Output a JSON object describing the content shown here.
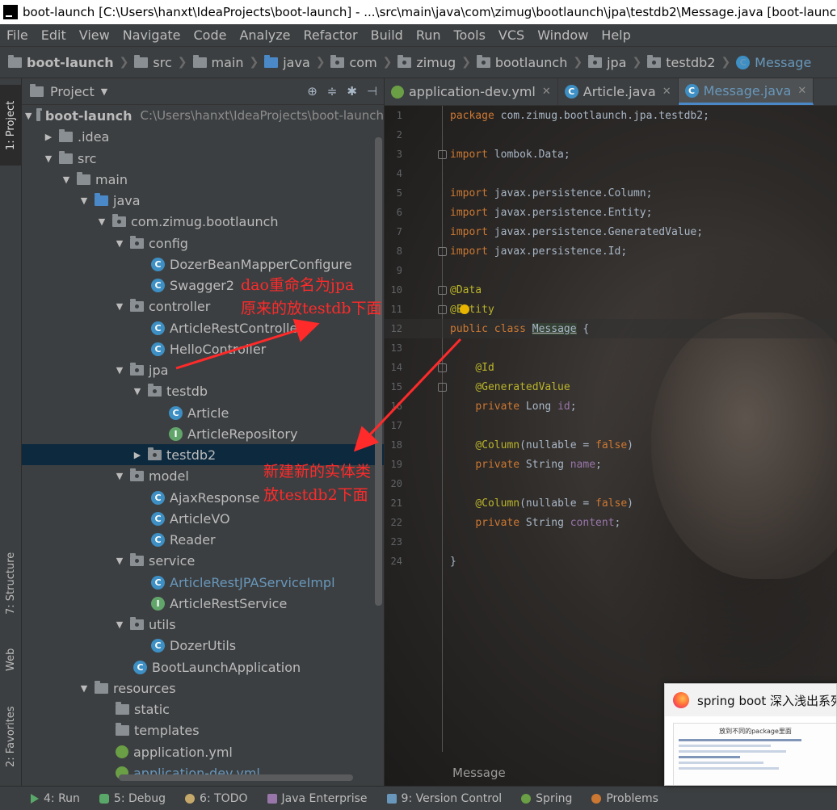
{
  "window_title": "boot-launch [C:\\Users\\hanxt\\IdeaProjects\\boot-launch] - ...\\src\\main\\java\\com\\zimug\\bootlaunch\\jpa\\testdb2\\Message.java [boot-launch] -",
  "menu": [
    "File",
    "Edit",
    "View",
    "Navigate",
    "Code",
    "Analyze",
    "Refactor",
    "Build",
    "Run",
    "Tools",
    "VCS",
    "Window",
    "Help"
  ],
  "breadcrumb": [
    "boot-launch",
    "src",
    "main",
    "java",
    "com",
    "zimug",
    "bootlaunch",
    "jpa",
    "testdb2",
    "Message"
  ],
  "left_tools": {
    "project": "1: Project",
    "structure": "7: Structure",
    "web": "Web",
    "favorites": "2: Favorites"
  },
  "project_panel": {
    "title": "Project"
  },
  "tree": [
    {
      "label": "boot-launch",
      "path": "C:\\Users\\hanxt\\IdeaProjects\\boot-launch"
    },
    {
      "label": ".idea"
    },
    {
      "label": "src"
    },
    {
      "label": "main"
    },
    {
      "label": "java"
    },
    {
      "label": "com.zimug.bootlaunch"
    },
    {
      "label": "config"
    },
    {
      "label": "DozerBeanMapperConfigure"
    },
    {
      "label": "Swagger2"
    },
    {
      "label": "controller"
    },
    {
      "label": "ArticleRestController"
    },
    {
      "label": "HelloController"
    },
    {
      "label": "jpa"
    },
    {
      "label": "testdb"
    },
    {
      "label": "Article"
    },
    {
      "label": "ArticleRepository"
    },
    {
      "label": "testdb2"
    },
    {
      "label": "model"
    },
    {
      "label": "AjaxResponse"
    },
    {
      "label": "ArticleVO"
    },
    {
      "label": "Reader"
    },
    {
      "label": "service"
    },
    {
      "label": "ArticleRestJPAServiceImpl"
    },
    {
      "label": "ArticleRestService"
    },
    {
      "label": "utils"
    },
    {
      "label": "DozerUtils"
    },
    {
      "label": "BootLaunchApplication"
    },
    {
      "label": "resources"
    },
    {
      "label": "static"
    },
    {
      "label": "templates"
    },
    {
      "label": "application.yml"
    },
    {
      "label": "application-dev.yml"
    }
  ],
  "tabs": [
    "application-dev.yml",
    "Article.java",
    "Message.java"
  ],
  "code": [
    {
      "n": "1",
      "t": "package com.zimug.bootlaunch.jpa.testdb2;"
    },
    {
      "n": "2",
      "t": ""
    },
    {
      "n": "3",
      "t": "import lombok.Data;"
    },
    {
      "n": "4",
      "t": ""
    },
    {
      "n": "5",
      "t": "import javax.persistence.Column;"
    },
    {
      "n": "6",
      "t": "import javax.persistence.Entity;"
    },
    {
      "n": "7",
      "t": "import javax.persistence.GeneratedValue;"
    },
    {
      "n": "8",
      "t": "import javax.persistence.Id;"
    },
    {
      "n": "9",
      "t": ""
    },
    {
      "n": "10",
      "t": "@Data"
    },
    {
      "n": "11",
      "t": "@Entity"
    },
    {
      "n": "12",
      "t": "public class Message {"
    },
    {
      "n": "13",
      "t": ""
    },
    {
      "n": "14",
      "t": "    @Id"
    },
    {
      "n": "15",
      "t": "    @GeneratedValue"
    },
    {
      "n": "16",
      "t": "    private Long id;"
    },
    {
      "n": "17",
      "t": ""
    },
    {
      "n": "18",
      "t": "    @Column(nullable = false)"
    },
    {
      "n": "19",
      "t": "    private String name;"
    },
    {
      "n": "20",
      "t": ""
    },
    {
      "n": "21",
      "t": "    @Column(nullable = false)"
    },
    {
      "n": "22",
      "t": "    private String content;"
    },
    {
      "n": "23",
      "t": ""
    },
    {
      "n": "24",
      "t": "}"
    }
  ],
  "editor_footer_crumb": "Message",
  "annotations": {
    "first_line1": "dao重命名为jpa",
    "first_line2": "原来的放testdb下面",
    "second_line1": "新建新的实体类",
    "second_line2": "放testdb2下面"
  },
  "status_tools": [
    {
      "label": "4: Run"
    },
    {
      "label": "5: Debug"
    },
    {
      "label": "6: TODO"
    },
    {
      "label": "Java Enterprise"
    },
    {
      "label": "9: Version Control"
    },
    {
      "label": "Spring"
    },
    {
      "label": "Problems"
    }
  ],
  "popup": {
    "title": "spring boot 深入浅出系列",
    "thumb_heading": "放到不同的package里面"
  },
  "colors": {
    "keyword": "#cc7832",
    "annotation": "#bbb529",
    "field": "#9876aa",
    "annotation_text": "#ff2a2a",
    "selection": "#0d293e"
  }
}
